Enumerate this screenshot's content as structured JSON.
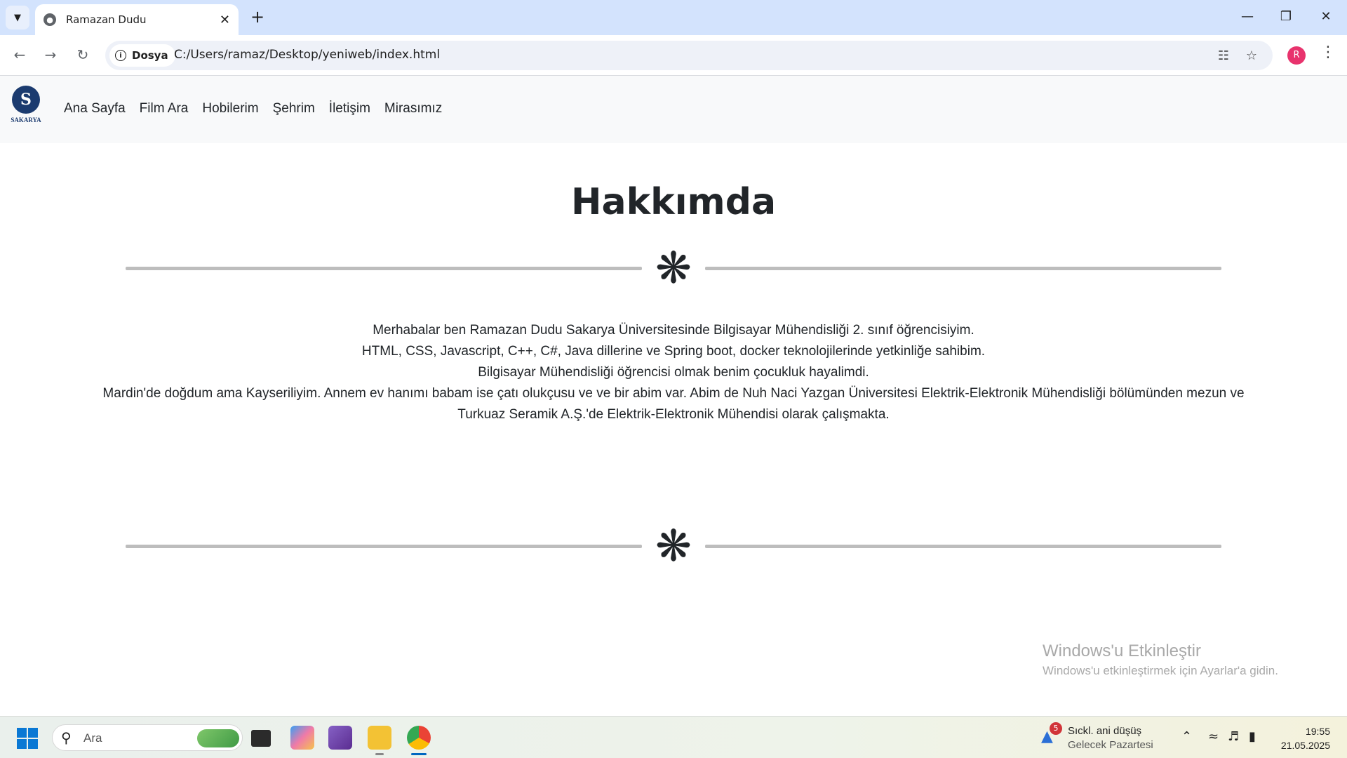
{
  "browser": {
    "tab_title": "Ramazan Dudu",
    "site_chip": "Dosya",
    "url": "C:/Users/ramaz/Desktop/yeniweb/index.html",
    "profile_initial": "R"
  },
  "site": {
    "logo_text": "SAKARYA",
    "nav": [
      "Ana Sayfa",
      "Film Ara",
      "Hobilerim",
      "Şehrim",
      "İletişim",
      "Mirasımız"
    ]
  },
  "content": {
    "heading": "Hakkımda",
    "paragraphs": [
      "Merhabalar ben Ramazan Dudu Sakarya Üniversitesinde Bilgisayar Mühendisliği 2. sınıf öğrencisiyim.",
      "HTML, CSS, Javascript, C++, C#, Java dillerine ve Spring boot, docker teknolojilerinde yetkinliğe sahibim.",
      "Bilgisayar Mühendisliği öğrencisi olmak benim çocukluk hayalimdi.",
      "Mardin'de doğdum ama Kayseriliyim. Annem ev hanımı babam ise çatı olukçusu ve ve bir abim var. Abim de Nuh Naci Yazgan Üniversitesi Elektrik-Elektronik Mühendisliği bölümünden mezun ve Turkuaz Seramik A.Ş.'de Elektrik-Elektronik Mühendisi olarak çalışmakta."
    ]
  },
  "watermark": {
    "title": "Windows'u Etkinleştir",
    "subtitle": "Windows'u etkinleştirmek için Ayarlar'a gidin."
  },
  "taskbar": {
    "search_placeholder": "Ara",
    "weather_badge": "5",
    "weather_title": "Sıckl. ani düşüş",
    "weather_subtitle": "Gelecek Pazartesi",
    "time": "19:55",
    "date": "21.05.2025"
  },
  "colors": {
    "tabstrip": "#d3e3fd",
    "navbar": "#f8f9fa",
    "divider": "#bdbdbd",
    "profile": "#e8336d"
  }
}
